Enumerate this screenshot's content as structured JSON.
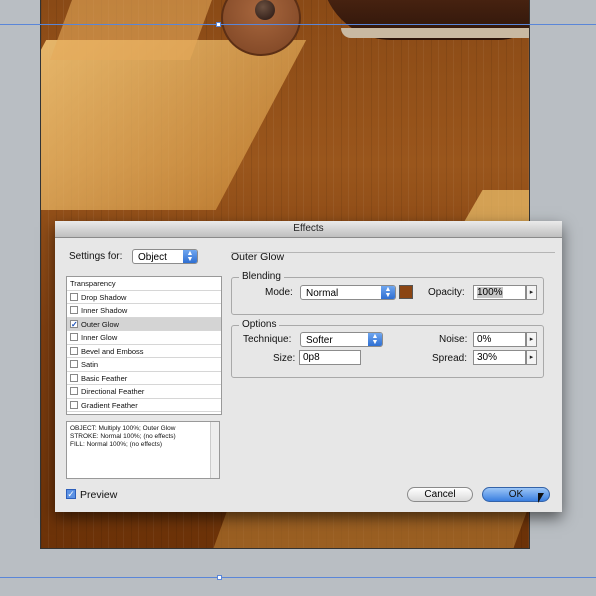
{
  "dialog": {
    "title": "Effects",
    "settings_for_label": "Settings for:",
    "settings_for_value": "Object",
    "effect_title": "Outer Glow"
  },
  "effects_list": [
    {
      "label": "Transparency",
      "checkbox": false,
      "checked": false,
      "selected": false
    },
    {
      "label": "Drop Shadow",
      "checkbox": true,
      "checked": false,
      "selected": false
    },
    {
      "label": "Inner Shadow",
      "checkbox": true,
      "checked": false,
      "selected": false
    },
    {
      "label": "Outer Glow",
      "checkbox": true,
      "checked": true,
      "selected": true
    },
    {
      "label": "Inner Glow",
      "checkbox": true,
      "checked": false,
      "selected": false
    },
    {
      "label": "Bevel and Emboss",
      "checkbox": true,
      "checked": false,
      "selected": false
    },
    {
      "label": "Satin",
      "checkbox": true,
      "checked": false,
      "selected": false
    },
    {
      "label": "Basic Feather",
      "checkbox": true,
      "checked": false,
      "selected": false
    },
    {
      "label": "Directional Feather",
      "checkbox": true,
      "checked": false,
      "selected": false
    },
    {
      "label": "Gradient Feather",
      "checkbox": true,
      "checked": false,
      "selected": false
    }
  ],
  "summary": {
    "line1": "OBJECT: Multiply 100%; Outer Glow",
    "line2": "STROKE: Normal 100%; (no effects)",
    "line3": "FILL: Normal 100%; (no effects)"
  },
  "blending": {
    "title": "Blending",
    "mode_label": "Mode:",
    "mode_value": "Normal",
    "swatch_color": "#8b4513",
    "opacity_label": "Opacity:",
    "opacity_value": "100%"
  },
  "options": {
    "title": "Options",
    "technique_label": "Technique:",
    "technique_value": "Softer",
    "noise_label": "Noise:",
    "noise_value": "0%",
    "size_label": "Size:",
    "size_value": "0p8",
    "spread_label": "Spread:",
    "spread_value": "30%"
  },
  "footer": {
    "preview_label": "Preview",
    "preview_checked": true,
    "cancel_label": "Cancel",
    "ok_label": "OK"
  },
  "colors": {
    "accent": "#3a7fe0",
    "guide": "#5a86d8"
  }
}
